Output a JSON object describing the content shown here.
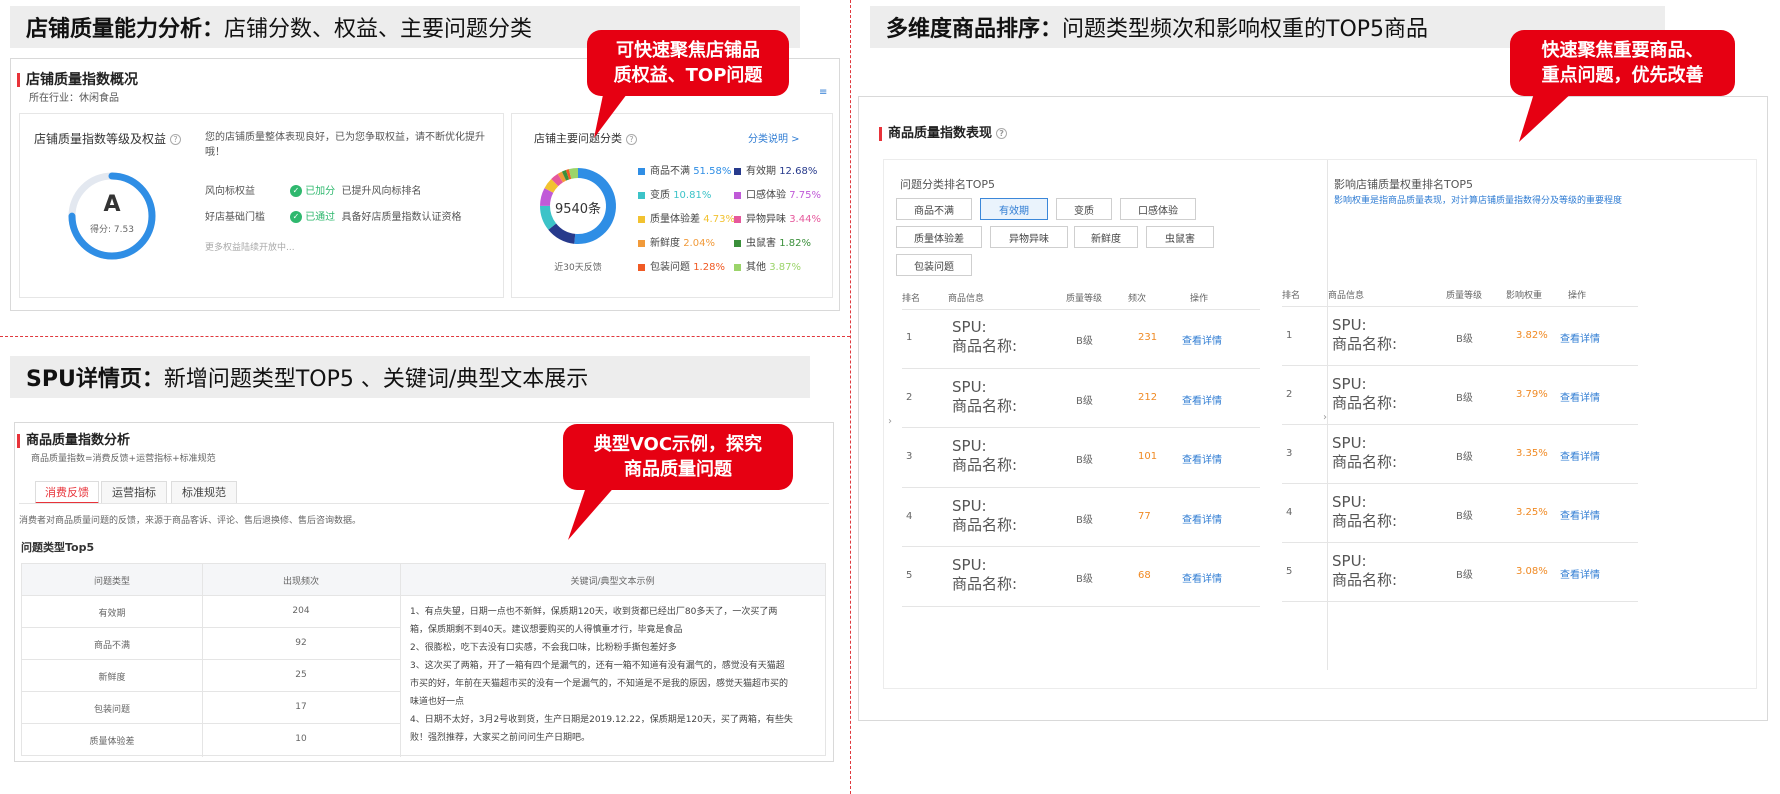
{
  "sections": {
    "store": {
      "bold": "店铺质量能力分析：",
      "rest": "店铺分数、权益、主要问题分类"
    },
    "rank": {
      "bold": "多维度商品排序：",
      "rest": "问题类型频次和影响权重的TOP5商品"
    },
    "spu": {
      "bold": "SPU详情页：",
      "rest": "新增问题类型TOP5 、关键词/典型文本展示"
    }
  },
  "bubbles": {
    "store": [
      "可快速聚焦店铺品",
      "质权益、TOP问题"
    ],
    "rank": [
      "快速聚焦重要商品、",
      "重点问题，优先改善"
    ],
    "spu": [
      "典型VOC示例，探究",
      "商品质量问题"
    ]
  },
  "store_panel": {
    "title": "店铺质量指数概况",
    "industry": "所在行业：休闲食品",
    "grade_title": "店铺质量指数等级及权益",
    "grade": "A",
    "score": "得分: 7.53",
    "desc": [
      "您的店铺质量整体表现良好，已为您争取权益，请不断优化提升",
      "哦！"
    ],
    "rights": [
      {
        "label": "风向标权益",
        "status": "已加分",
        "detail": "已提升风向标排名"
      },
      {
        "label": "好店基础门槛",
        "status": "已通过",
        "detail": "具备好店质量指数认证资格"
      }
    ],
    "more": "更多权益陆续开放中...",
    "issues_title": "店铺主要问题分类",
    "issues_link": "分类说明 >",
    "donut_total": "9540条",
    "donut_caption": "近30天反馈",
    "legend": [
      {
        "name": "商品不满",
        "pct": "51.58%",
        "color": "#2f8ee5"
      },
      {
        "name": "有效期",
        "pct": "12.68%",
        "color": "#273a8c"
      },
      {
        "name": "变质",
        "pct": "10.81%",
        "color": "#3cc3c8"
      },
      {
        "name": "口感体验",
        "pct": "7.75%",
        "color": "#c05ad8"
      },
      {
        "name": "质量体验差",
        "pct": "4.73%",
        "color": "#f2c230"
      },
      {
        "name": "异物异味",
        "pct": "3.44%",
        "color": "#e6589c"
      },
      {
        "name": "新鲜度",
        "pct": "2.04%",
        "color": "#f19a3a"
      },
      {
        "name": "虫鼠害",
        "pct": "1.82%",
        "color": "#3a8f3a"
      },
      {
        "name": "包装问题",
        "pct": "1.28%",
        "color": "#f05a24"
      },
      {
        "name": "其他",
        "pct": "3.87%",
        "color": "#9bd46a"
      }
    ]
  },
  "rank_panel": {
    "title": "商品质量指数表现",
    "left_title": "问题分类排名TOP5",
    "tags": [
      "商品不满",
      "有效期",
      "变质",
      "口感体验",
      "质量体验差",
      "异物异味",
      "新鲜度",
      "虫鼠害",
      "包装问题"
    ],
    "active_tag": "有效期",
    "left_headers": [
      "排名",
      "商品信息",
      "质量等级",
      "频次",
      "操作"
    ],
    "left_rows": [
      {
        "rank": "1",
        "spu": "SPU:",
        "name": "商品名称:",
        "grade": "B级",
        "value": "231",
        "op": "查看详情"
      },
      {
        "rank": "2",
        "spu": "SPU:",
        "name": "商品名称:",
        "grade": "B级",
        "value": "212",
        "op": "查看详情"
      },
      {
        "rank": "3",
        "spu": "SPU:",
        "name": "商品名称:",
        "grade": "B级",
        "value": "101",
        "op": "查看详情"
      },
      {
        "rank": "4",
        "spu": "SPU:",
        "name": "商品名称:",
        "grade": "B级",
        "value": "77",
        "op": "查看详情"
      },
      {
        "rank": "5",
        "spu": "SPU:",
        "name": "商品名称:",
        "grade": "B级",
        "value": "68",
        "op": "查看详情"
      }
    ],
    "right_title": "影响店铺质量权重排名TOP5",
    "right_note": "影响权重是指商品质量表现，对计算店铺质量指数得分及等级的重要程度",
    "right_headers": [
      "排名",
      "商品信息",
      "质量等级",
      "影响权重",
      "操作"
    ],
    "right_rows": [
      {
        "rank": "1",
        "spu": "SPU:",
        "name": "商品名称:",
        "grade": "B级",
        "value": "3.82%",
        "op": "查看详情"
      },
      {
        "rank": "2",
        "spu": "SPU:",
        "name": "商品名称:",
        "grade": "B级",
        "value": "3.79%",
        "op": "查看详情"
      },
      {
        "rank": "3",
        "spu": "SPU:",
        "name": "商品名称:",
        "grade": "B级",
        "value": "3.35%",
        "op": "查看详情"
      },
      {
        "rank": "4",
        "spu": "SPU:",
        "name": "商品名称:",
        "grade": "B级",
        "value": "3.25%",
        "op": "查看详情"
      },
      {
        "rank": "5",
        "spu": "SPU:",
        "name": "商品名称:",
        "grade": "B级",
        "value": "3.08%",
        "op": "查看详情"
      }
    ]
  },
  "spu_panel": {
    "title": "商品质量指数分析",
    "formula": "商品质量指数=消费反馈+运营指标+标准规范",
    "tabs": [
      "消费反馈",
      "运营指标",
      "标准规范"
    ],
    "active_tab": "消费反馈",
    "desc": "消费者对商品质量问题的反馈，来源于商品客诉、评论、售后退换修、售后咨询数据。",
    "top5_title": "问题类型Top5",
    "headers": [
      "问题类型",
      "出现频次",
      "关键词/典型文本示例"
    ],
    "rows": [
      {
        "type": "有效期",
        "count": "204"
      },
      {
        "type": "商品不满",
        "count": "92"
      },
      {
        "type": "新鲜度",
        "count": "25"
      },
      {
        "type": "包装问题",
        "count": "17"
      },
      {
        "type": "质量体验差",
        "count": "10"
      }
    ],
    "examples": [
      "1、有点失望，日期一点也不新鲜，保质期120天，收到货都已经出厂80多天了，一次买了两",
      "箱，保质期剩不到40天。建议想要购买的人得慎重才行，毕竟是食品",
      "2、很膨松，吃下去没有口实感，不会我口味，比粉粉手撕包差好多",
      "3、这次买了两箱，开了一箱有四个是漏气的，还有一箱不知道有没有漏气的，感觉没有天猫超",
      "市买的好，年前在天猫超市买的没有一个是漏气的，不知道是不是我的原因，感觉天猫超市买的",
      "味道也好一点",
      "4、日期不太好，3月2号收到货，生产日期是2019.12.22，保质期是120天，买了两箱，有些失",
      "败！强烈推荐，大家买之前问问生产日期吧。"
    ]
  }
}
